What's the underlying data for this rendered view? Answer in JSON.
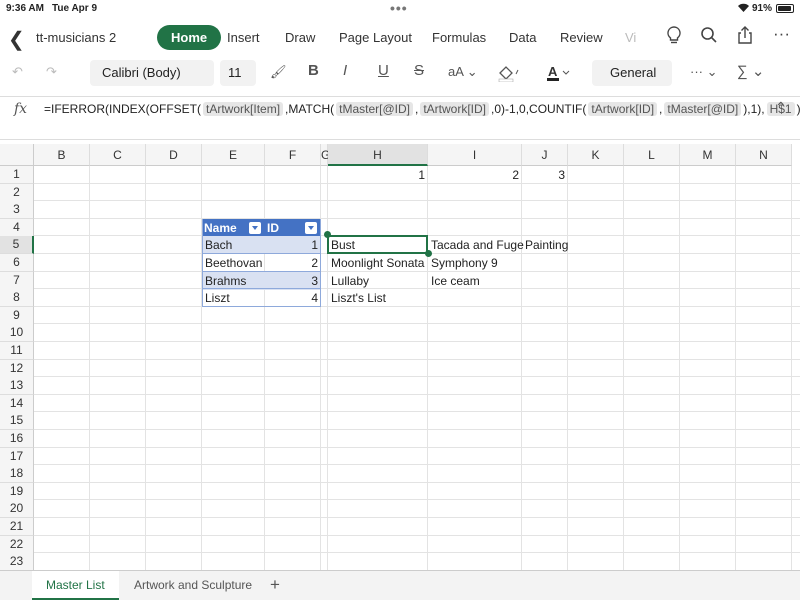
{
  "status": {
    "time": "9:36 AM",
    "date": "Tue Apr 9",
    "battery": "91%"
  },
  "app": {
    "doc_title": "tt-musicians 2",
    "tabs": [
      "Home",
      "Insert",
      "Draw",
      "Page Layout",
      "Formulas",
      "Data",
      "Review",
      "Vi"
    ],
    "active_tab": "Home"
  },
  "toolbar": {
    "font": "Calibri (Body)",
    "size": "11",
    "number_format": "General"
  },
  "formula_bar": {
    "fx": "fx",
    "parts": [
      {
        "t": "=IFERROR(INDEX(OFFSET(",
        "ref": false
      },
      {
        "t": "tArtwork[Item]",
        "ref": true
      },
      {
        "t": ",MATCH(",
        "ref": false
      },
      {
        "t": "tMaster[@ID]",
        "ref": true
      },
      {
        "t": ",",
        "ref": false
      },
      {
        "t": "tArtwork[ID]",
        "ref": true
      },
      {
        "t": ",0)-1,0,COUNTIF(",
        "ref": false
      },
      {
        "t": "tArtwork[ID]",
        "ref": true
      },
      {
        "t": ",",
        "ref": false
      },
      {
        "t": "tMaster[@ID]",
        "ref": true
      },
      {
        "t": "),1),",
        "ref": false
      },
      {
        "t": "H$1",
        "ref": true
      },
      {
        "t": "),\"\")",
        "ref": false
      }
    ]
  },
  "grid": {
    "columns": [
      "B",
      "C",
      "D",
      "E",
      "F",
      "G",
      "H",
      "I",
      "J",
      "K",
      "L",
      "M",
      "N"
    ],
    "rows": [
      "1",
      "2",
      "3",
      "4",
      "5",
      "6",
      "7",
      "8",
      "9",
      "10",
      "11",
      "12",
      "13",
      "14",
      "15",
      "16",
      "17",
      "18",
      "19",
      "20",
      "21",
      "22",
      "23"
    ],
    "selected_column": "H",
    "selected_row": "5",
    "headers_row1": [
      "1",
      "2",
      "3"
    ],
    "table": {
      "headers": [
        "Name",
        "ID"
      ],
      "rows": [
        {
          "name": "Bach",
          "id": "1"
        },
        {
          "name": "Beethovan",
          "id": "2"
        },
        {
          "name": "Brahms",
          "id": "3"
        },
        {
          "name": "Liszt",
          "id": "4"
        }
      ]
    },
    "results": [
      [
        "Bust",
        "Tacada and Fuge",
        "Painting"
      ],
      [
        "Moonlight Sonata",
        "Symphony 9",
        ""
      ],
      [
        "Lullaby",
        "Ice ceam",
        ""
      ],
      [
        "Liszt's List",
        "",
        ""
      ]
    ]
  },
  "sheets": [
    "Master List",
    "Artwork and Sculpture"
  ],
  "active_sheet": "Master List"
}
